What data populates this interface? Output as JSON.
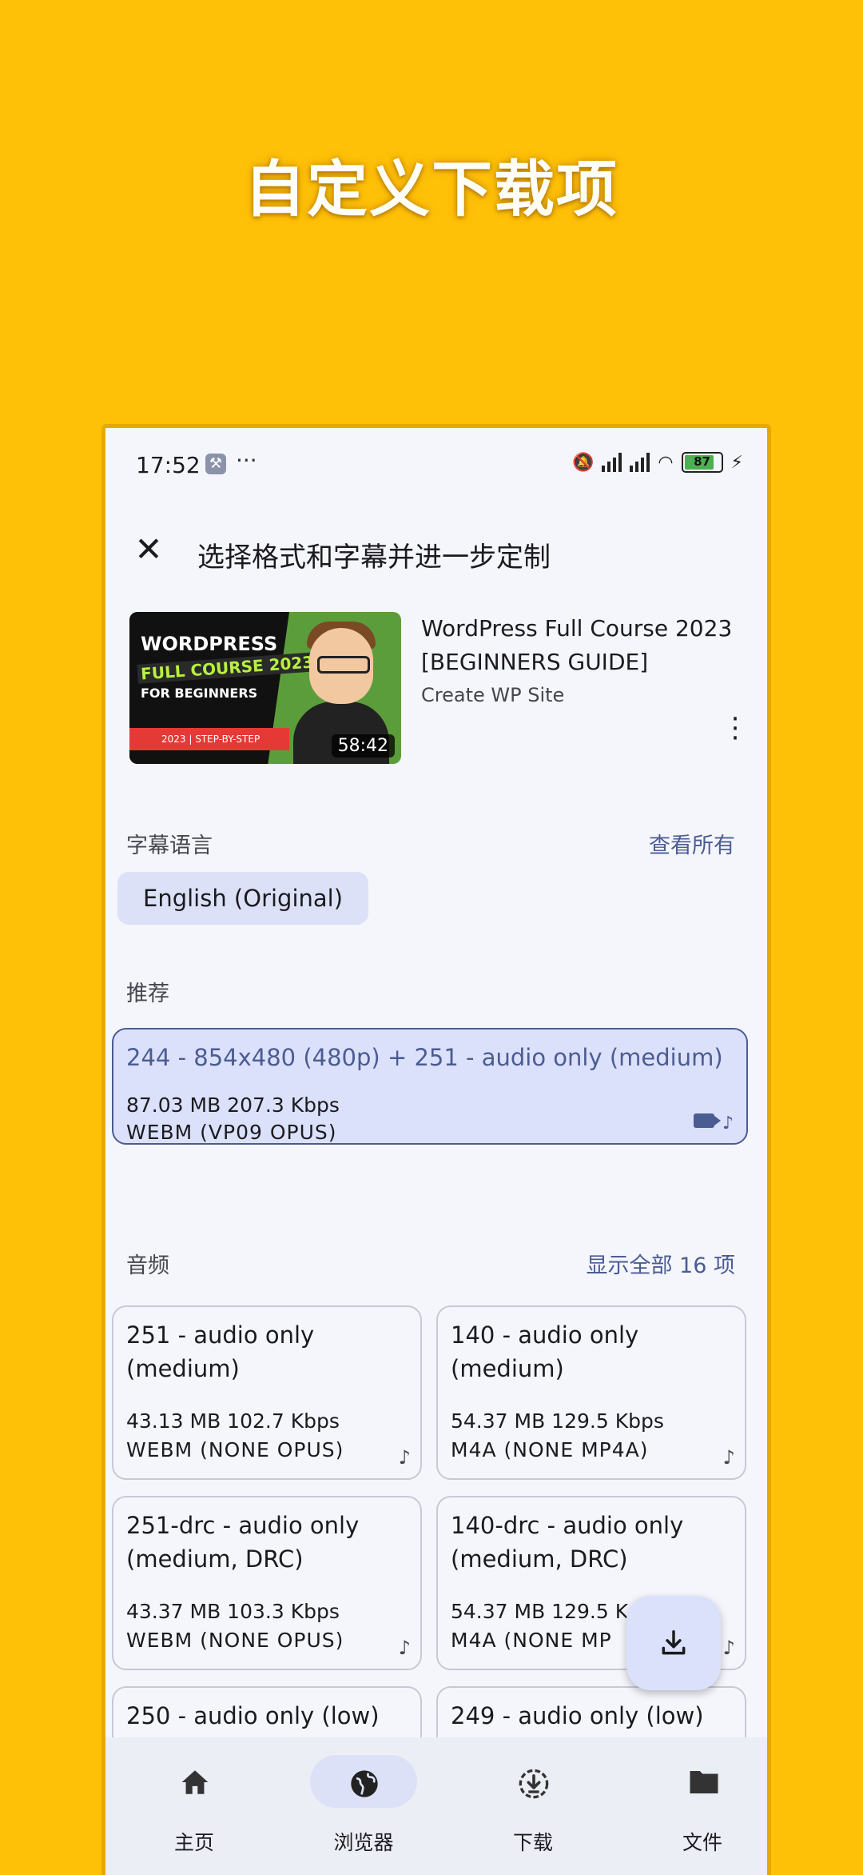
{
  "promo": {
    "title": "自定义下载项"
  },
  "status_bar": {
    "time": "17:52",
    "dots": "···",
    "battery": "87"
  },
  "top_bar": {
    "title": "选择格式和字幕并进一步定制",
    "close_icon": "close-icon"
  },
  "video": {
    "title": "WordPress Full Course 2023 [BEGINNERS GUIDE]",
    "channel": "Create WP Site",
    "duration": "58:42",
    "thumbnail_text": {
      "line1": "WORDPRESS",
      "line2": "FULL COURSE 2023",
      "line3": "FOR BEGINNERS",
      "line4": "2023 | STEP-BY-STEP"
    }
  },
  "subtitles": {
    "label": "字幕语言",
    "action": "查看所有",
    "chip": "English (Original)"
  },
  "recommended": {
    "label": "推荐",
    "title": "244 - 854x480 (480p) + 251 - audio only (medium)",
    "size": "87.03 MB 207.3 Kbps",
    "format": "WEBM (VP09 OPUS)"
  },
  "audio": {
    "label": "音频",
    "action": "显示全部 16 项",
    "cards": [
      {
        "title": "251 - audio only (medium)",
        "size": "43.13 MB 102.7 Kbps",
        "format": "WEBM (NONE OPUS)"
      },
      {
        "title": "140 - audio only (medium)",
        "size": "54.37 MB 129.5 Kbps",
        "format": "M4A (NONE MP4A)"
      },
      {
        "title": "251-drc - audio only (medium, DRC)",
        "size": "43.37 MB 103.3 Kbps",
        "format": "WEBM (NONE OPUS)"
      },
      {
        "title": "140-drc - audio only (medium, DRC)",
        "size": "54.37 MB 129.5 K",
        "format": "M4A (NONE MP"
      },
      {
        "title": "250 - audio only (low)",
        "size": "",
        "format": ""
      },
      {
        "title": "249 - audio only (low)",
        "size": "",
        "format": ""
      }
    ]
  },
  "nav": [
    {
      "label": "主页",
      "icon": "home-icon"
    },
    {
      "label": "浏览器",
      "icon": "globe-icon",
      "active": true
    },
    {
      "label": "下载",
      "icon": "download-circle-icon"
    },
    {
      "label": "文件",
      "icon": "folder-icon"
    }
  ],
  "colors": {
    "background": "#FFC107",
    "accent": "#4B5C92",
    "chip": "#DCE1F7",
    "surface": "#F5F6FC"
  }
}
